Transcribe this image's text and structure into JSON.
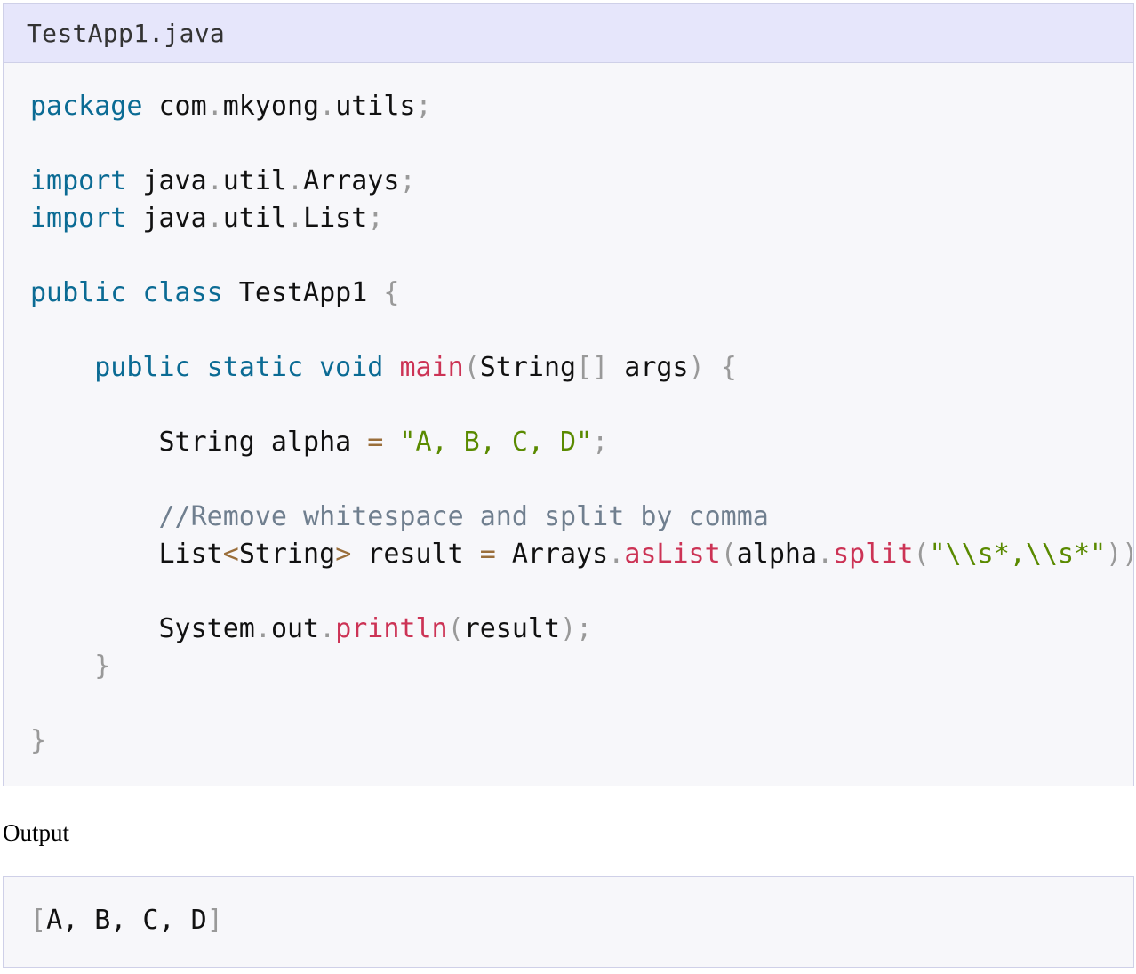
{
  "code_block": {
    "filename": "TestApp1.java",
    "lines": [
      [
        {
          "t": "package",
          "c": "kw"
        },
        {
          "t": " com"
        },
        {
          "t": ".",
          "c": "pn"
        },
        {
          "t": "mkyong"
        },
        {
          "t": ".",
          "c": "pn"
        },
        {
          "t": "utils"
        },
        {
          "t": ";",
          "c": "pn"
        }
      ],
      [],
      [
        {
          "t": "import",
          "c": "kw"
        },
        {
          "t": " java"
        },
        {
          "t": ".",
          "c": "pn"
        },
        {
          "t": "util"
        },
        {
          "t": ".",
          "c": "pn"
        },
        {
          "t": "Arrays"
        },
        {
          "t": ";",
          "c": "pn"
        }
      ],
      [
        {
          "t": "import",
          "c": "kw"
        },
        {
          "t": " java"
        },
        {
          "t": ".",
          "c": "pn"
        },
        {
          "t": "util"
        },
        {
          "t": ".",
          "c": "pn"
        },
        {
          "t": "List"
        },
        {
          "t": ";",
          "c": "pn"
        }
      ],
      [],
      [
        {
          "t": "public",
          "c": "kw"
        },
        {
          "t": " "
        },
        {
          "t": "class",
          "c": "kw"
        },
        {
          "t": " TestApp1 "
        },
        {
          "t": "{",
          "c": "pn"
        }
      ],
      [],
      [
        {
          "t": "    "
        },
        {
          "t": "public",
          "c": "kw"
        },
        {
          "t": " "
        },
        {
          "t": "static",
          "c": "kw"
        },
        {
          "t": " "
        },
        {
          "t": "void",
          "c": "kw"
        },
        {
          "t": " "
        },
        {
          "t": "main",
          "c": "fn"
        },
        {
          "t": "(",
          "c": "pn"
        },
        {
          "t": "String"
        },
        {
          "t": "[]",
          "c": "pn"
        },
        {
          "t": " args"
        },
        {
          "t": ")",
          "c": "pn"
        },
        {
          "t": " "
        },
        {
          "t": "{",
          "c": "pn"
        }
      ],
      [],
      [
        {
          "t": "        String alpha "
        },
        {
          "t": "=",
          "c": "op"
        },
        {
          "t": " "
        },
        {
          "t": "\"A, B, C, D\"",
          "c": "str"
        },
        {
          "t": ";",
          "c": "pn"
        }
      ],
      [],
      [
        {
          "t": "        "
        },
        {
          "t": "//Remove whitespace and split by comma",
          "c": "cm"
        }
      ],
      [
        {
          "t": "        List"
        },
        {
          "t": "<",
          "c": "op"
        },
        {
          "t": "String"
        },
        {
          "t": ">",
          "c": "op"
        },
        {
          "t": " result "
        },
        {
          "t": "=",
          "c": "op"
        },
        {
          "t": " Arrays"
        },
        {
          "t": ".",
          "c": "pn"
        },
        {
          "t": "asList",
          "c": "fn"
        },
        {
          "t": "(",
          "c": "pn"
        },
        {
          "t": "alpha"
        },
        {
          "t": ".",
          "c": "pn"
        },
        {
          "t": "split",
          "c": "fn"
        },
        {
          "t": "(",
          "c": "pn"
        },
        {
          "t": "\"\\\\s*,\\\\s*\"",
          "c": "str"
        },
        {
          "t": "));",
          "c": "pn"
        }
      ],
      [],
      [
        {
          "t": "        System"
        },
        {
          "t": ".",
          "c": "pn"
        },
        {
          "t": "out"
        },
        {
          "t": ".",
          "c": "pn"
        },
        {
          "t": "println",
          "c": "fn"
        },
        {
          "t": "(",
          "c": "pn"
        },
        {
          "t": "result"
        },
        {
          "t": ");",
          "c": "pn"
        }
      ],
      [
        {
          "t": "    "
        },
        {
          "t": "}",
          "c": "pn"
        }
      ],
      [],
      [
        {
          "t": "}",
          "c": "pn"
        }
      ]
    ]
  },
  "output_label": "Output",
  "output_block": {
    "lines": [
      [
        {
          "t": "[",
          "c": "pn"
        },
        {
          "t": "A, B, C, D"
        },
        {
          "t": "]",
          "c": "pn"
        }
      ]
    ]
  },
  "colors": {
    "keyword": "#0b6b94",
    "function": "#cc3355",
    "string": "#5a8a00",
    "punctuation": "#999999",
    "operator": "#9a6e3a",
    "comment": "#707f8f",
    "code_background": "#f7f7fa",
    "header_background": "#e6e6fb"
  }
}
